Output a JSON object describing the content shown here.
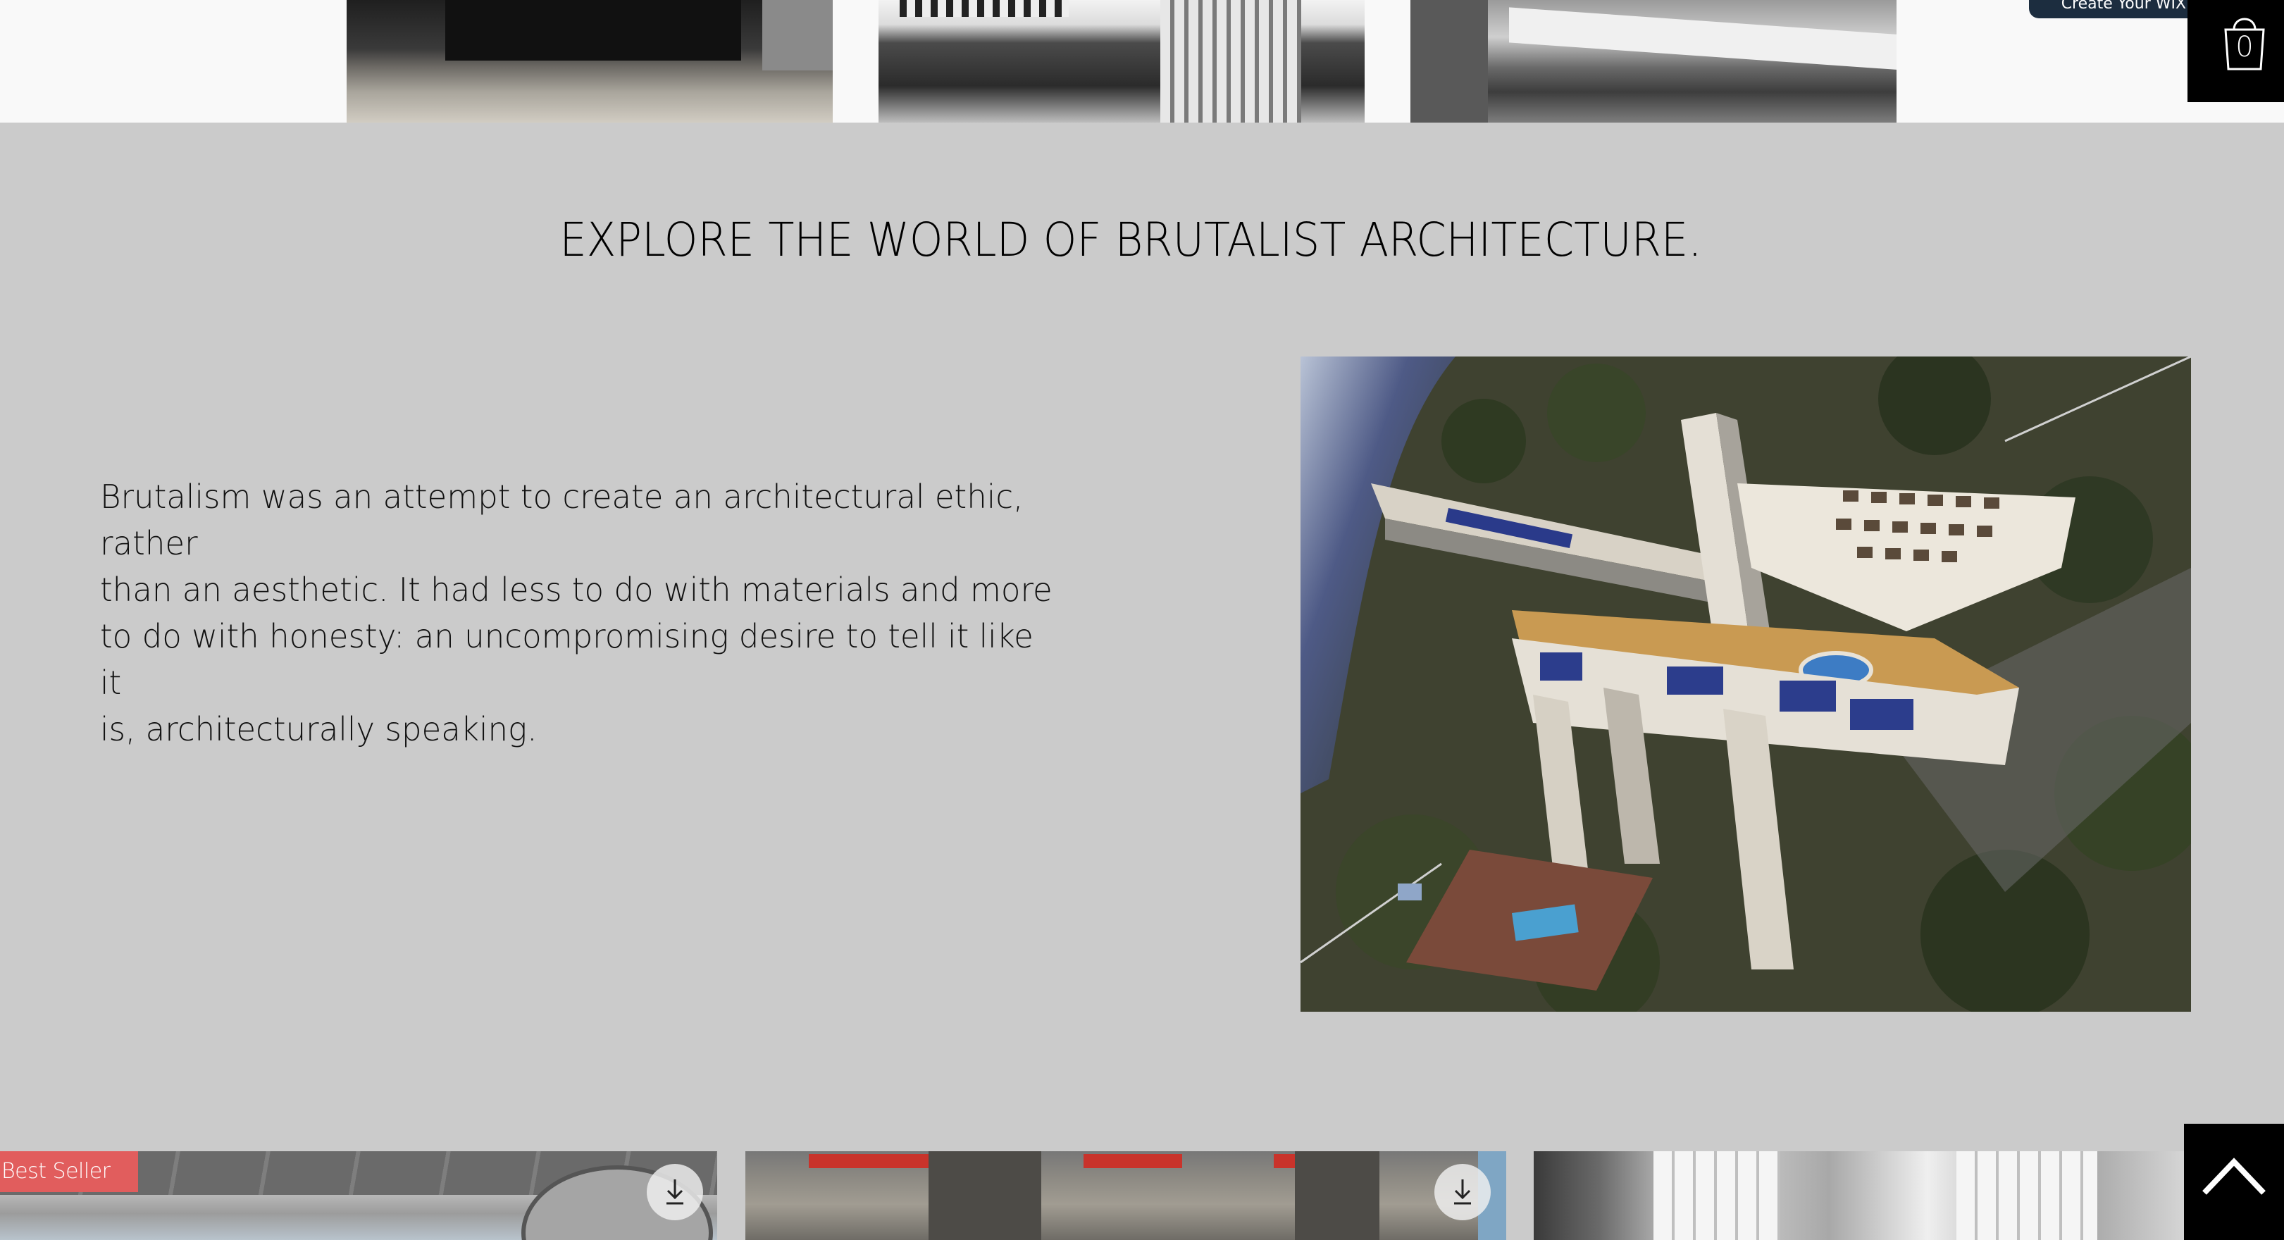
{
  "gallery": {
    "items": [
      {
        "alt": "brutalist building photo 1"
      },
      {
        "alt": "brutalist building photo 2"
      },
      {
        "alt": "brutalist building photo 3"
      }
    ]
  },
  "wix_banner": {
    "label": "Create Your WIX Site"
  },
  "cart": {
    "count": "0",
    "icon": "shopping-bag-icon"
  },
  "main": {
    "headline": "EXPLORE THE WORLD OF BRUTALIST ARCHITECTURE.",
    "intro_lines": [
      "Brutalism was an attempt to create an architectural ethic, rather",
      "than an aesthetic. It had less to do with materials and more",
      "to do with honesty: an uncompromising desire to tell it like it",
      "is, architecturally speaking."
    ]
  },
  "products": {
    "badge": "Best Seller",
    "download_icon": "download-icon",
    "items": [
      {
        "name": "product-1"
      },
      {
        "name": "product-2"
      },
      {
        "name": "product-3"
      }
    ]
  },
  "back_to_top": {
    "icon": "chevron-up-icon"
  },
  "colors": {
    "background": "#cbcbcb",
    "top_strip": "#f9f9f9",
    "badge": "#e15d5d",
    "wix_banner": "#1c2d3f",
    "black": "#000000"
  }
}
